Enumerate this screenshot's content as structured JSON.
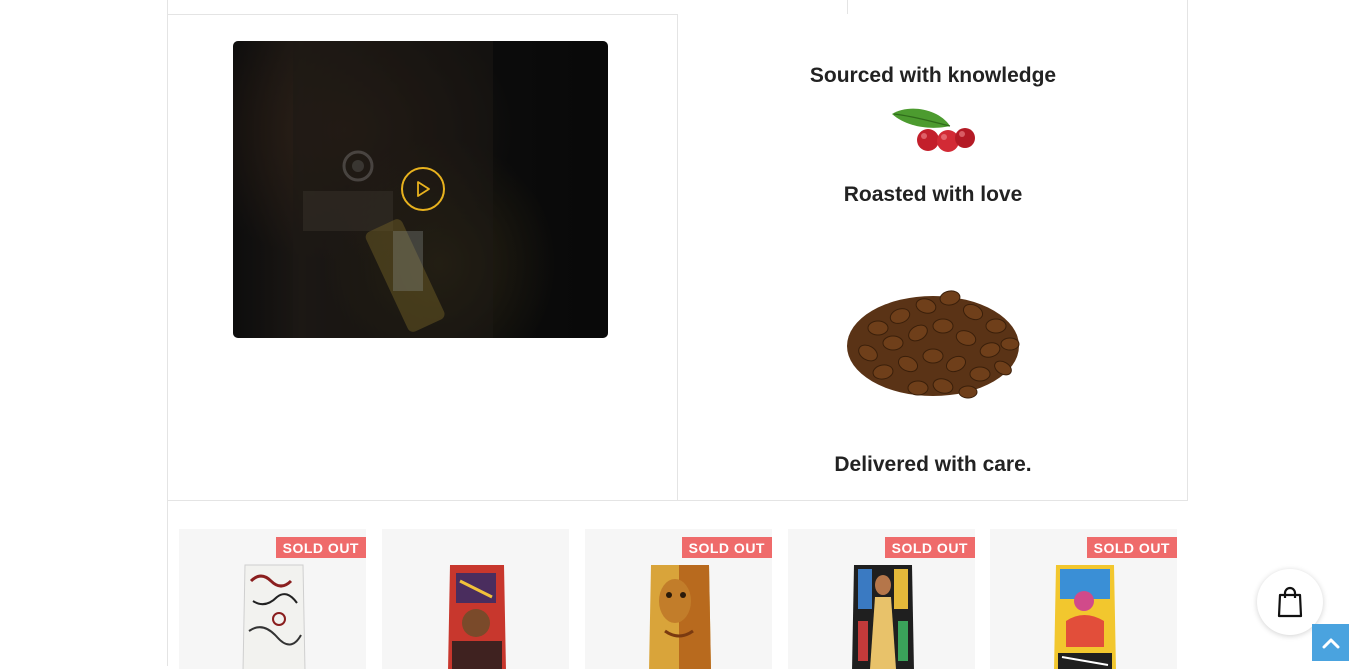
{
  "features": {
    "sourced": "Sourced with knowledge",
    "roasted": "Roasted with love",
    "delivered": "Delivered with care."
  },
  "video": {
    "play_icon": "play-icon"
  },
  "products": [
    {
      "badge": "SOLD OUT",
      "art": "white-sketch"
    },
    {
      "badge": "",
      "art": "red-portrait"
    },
    {
      "badge": "SOLD OUT",
      "art": "gold-face"
    },
    {
      "badge": "SOLD OUT",
      "art": "stained-glass-figure"
    },
    {
      "badge": "SOLD OUT",
      "art": "yellow-figure"
    }
  ],
  "floating": {
    "cart_icon": "shopping-bag-icon",
    "scroll_top_icon": "chevron-up-icon"
  },
  "colors": {
    "badge": "#ef6b6b",
    "play_accent": "#e8b21e",
    "scroll_button": "#4aa3df"
  }
}
